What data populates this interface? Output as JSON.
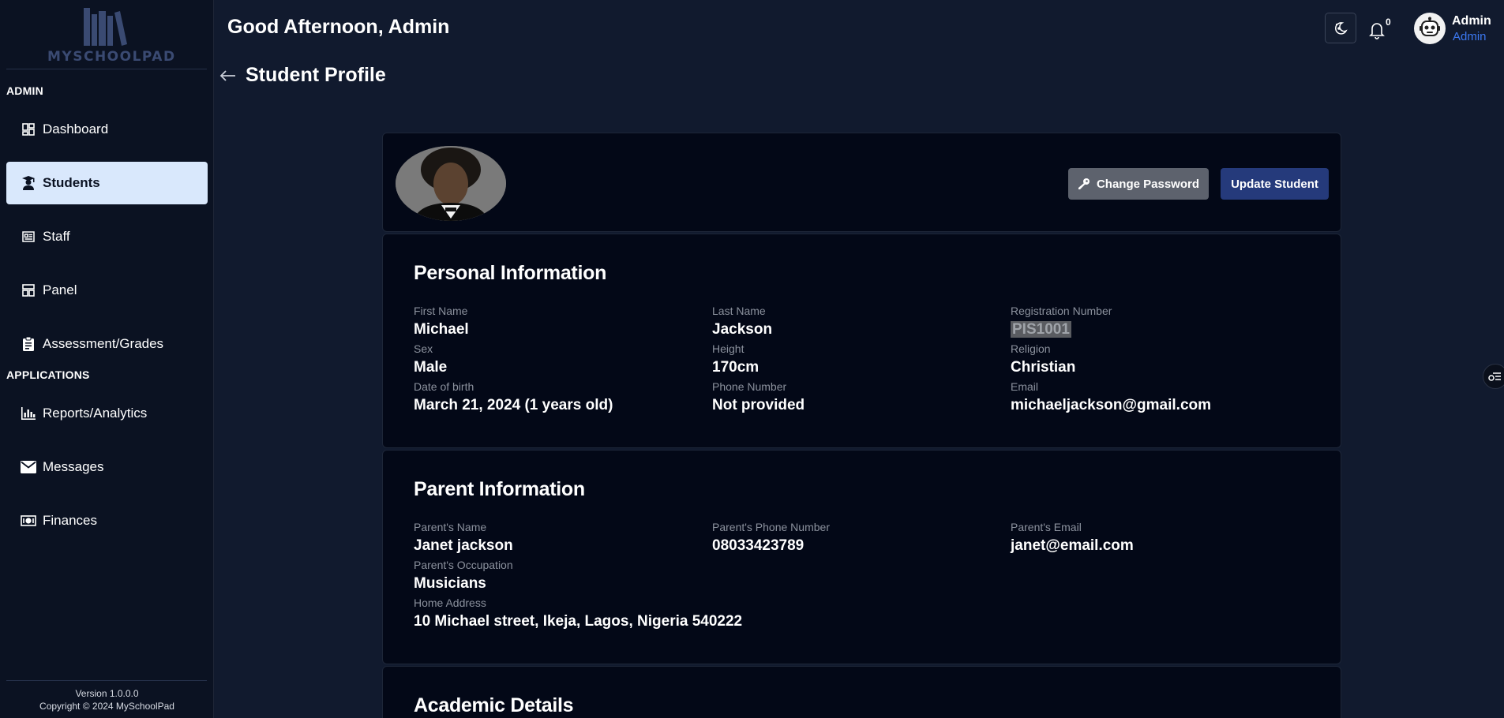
{
  "app": {
    "logo_text": "MYSCHOOLPAD"
  },
  "sidebar": {
    "section_admin": "ADMIN",
    "section_applications": "APPLICATIONS",
    "admin_items": [
      {
        "label": "Dashboard",
        "icon": "dashboard-grid-icon"
      },
      {
        "label": "Students",
        "icon": "student-graduate-icon",
        "active": true
      },
      {
        "label": "Staff",
        "icon": "staff-id-card-icon"
      },
      {
        "label": "Panel",
        "icon": "panel-layout-icon"
      },
      {
        "label": "Assessment/Grades",
        "icon": "clipboard-icon"
      }
    ],
    "application_items": [
      {
        "label": "Reports/Analytics",
        "icon": "bar-chart-icon"
      },
      {
        "label": "Messages",
        "icon": "envelope-icon"
      },
      {
        "label": "Finances",
        "icon": "money-icon"
      }
    ],
    "footer_version": "Version 1.0.0.0",
    "footer_copyright": "Copyright © 2024 MySchoolPad"
  },
  "header": {
    "greeting": "Good Afternoon, Admin",
    "notification_count": "0",
    "user_name": "Admin",
    "user_role": "Admin"
  },
  "page": {
    "title": "Student Profile"
  },
  "profile_actions": {
    "change_password": "Change Password",
    "update_student": "Update Student"
  },
  "personal": {
    "title": "Personal Information",
    "first_name_label": "First Name",
    "first_name": "Michael",
    "last_name_label": "Last Name",
    "last_name": "Jackson",
    "reg_label": "Registration Number",
    "reg_number": "PIS1001",
    "sex_label": "Sex",
    "sex": "Male",
    "height_label": "Height",
    "height": "170cm",
    "religion_label": "Religion",
    "religion": "Christian",
    "dob_label": "Date of birth",
    "dob": "March 21, 2024 (1 years old)",
    "phone_label": "Phone Number",
    "phone": "Not provided",
    "email_label": "Email",
    "email": "michaeljackson@gmail.com"
  },
  "parent": {
    "title": "Parent Information",
    "name_label": "Parent's Name",
    "name": "Janet jackson",
    "phone_label": "Parent's Phone Number",
    "phone": "08033423789",
    "email_label": "Parent's Email",
    "email": "janet@email.com",
    "occupation_label": "Parent's Occupation",
    "occupation": "Musicians",
    "address_label": "Home Address",
    "address": "10 Michael street, Ikeja, Lagos, Nigeria 540222"
  },
  "academic": {
    "title": "Academic Details"
  },
  "colors": {
    "background": "#111a2e",
    "sidebar": "#0b1222",
    "card": "#030817",
    "active_nav": "#d9e8fc",
    "primary_button": "#253a7b",
    "secondary_button": "#5d626d",
    "role_text": "#3c78f0"
  }
}
